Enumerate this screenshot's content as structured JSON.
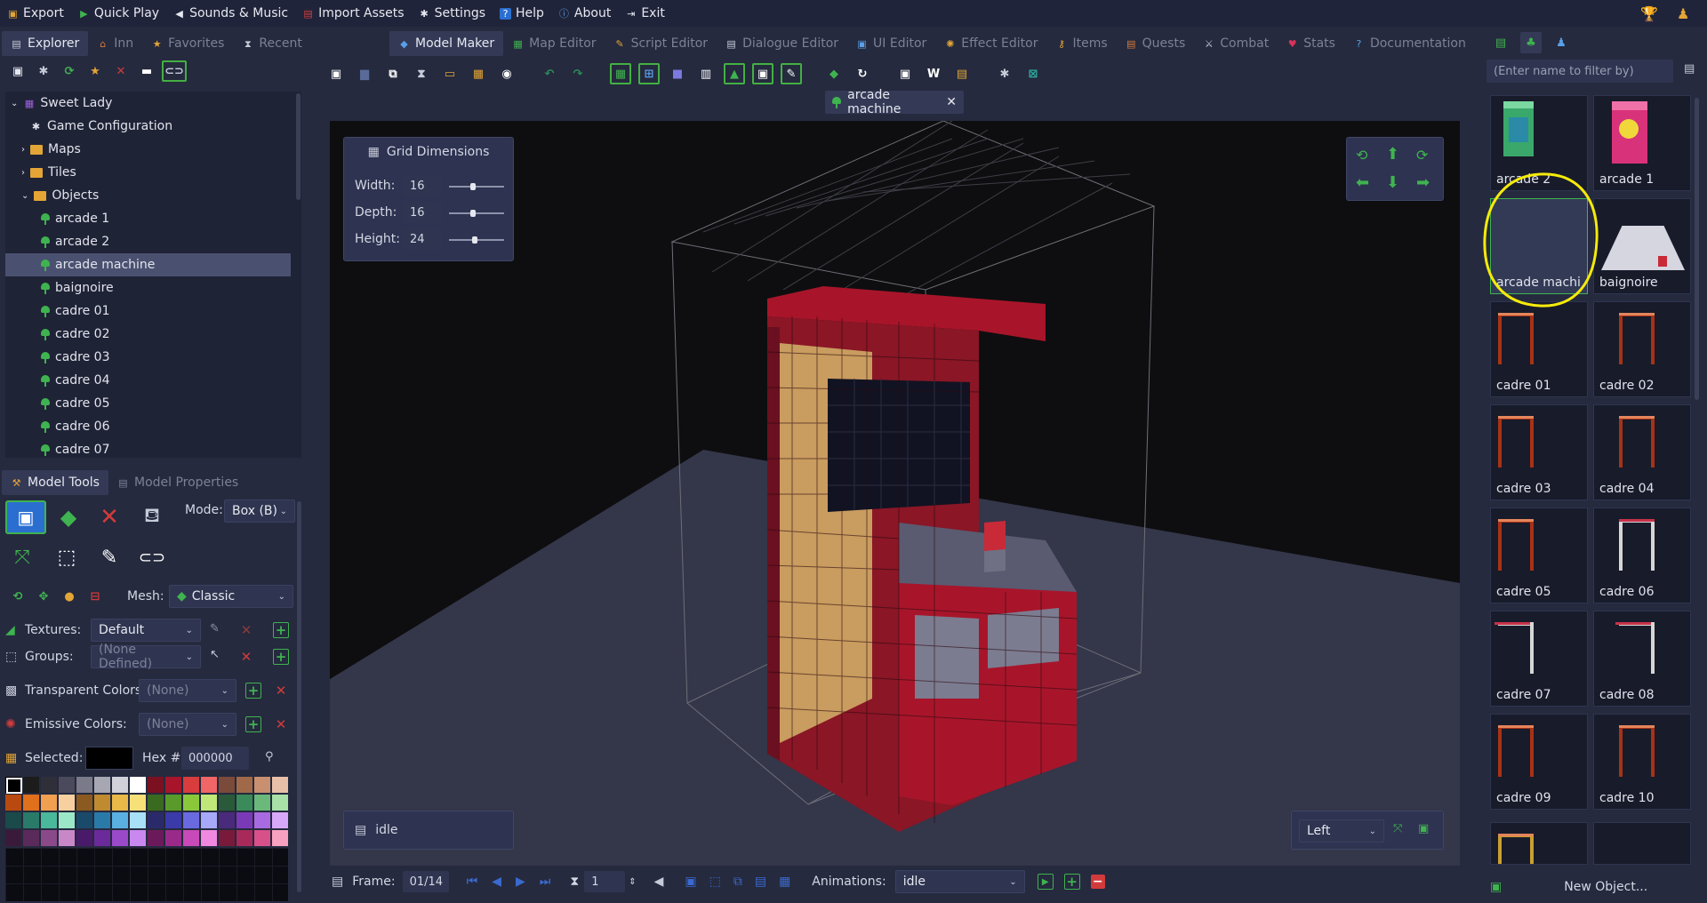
{
  "menu": [
    {
      "label": "Export",
      "icon": "export-icon"
    },
    {
      "label": "Quick Play",
      "icon": "play-icon"
    },
    {
      "label": "Sounds & Music",
      "icon": "speaker-icon"
    },
    {
      "label": "Import Assets",
      "icon": "import-icon"
    },
    {
      "label": "Settings",
      "icon": "gear-icon"
    },
    {
      "label": "Help",
      "icon": "help-icon"
    },
    {
      "label": "About",
      "icon": "info-icon"
    },
    {
      "label": "Exit",
      "icon": "exit-icon"
    }
  ],
  "left_tabs": [
    "Explorer",
    "Inn",
    "Favorites",
    "Recent"
  ],
  "editor_tabs": [
    "Model Maker",
    "Map Editor",
    "Script Editor",
    "Dialogue Editor",
    "UI Editor",
    "Effect Editor",
    "Items",
    "Quests",
    "Combat",
    "Stats",
    "Documentation"
  ],
  "tree": {
    "project": "Sweet Lady",
    "config": "Game Configuration",
    "maps": "Maps",
    "tiles": "Tiles",
    "objects": "Objects",
    "items": [
      "arcade 1",
      "arcade 2",
      "arcade machine",
      "baignoire",
      "cadre 01",
      "cadre 02",
      "cadre 03",
      "cadre 04",
      "cadre 05",
      "cadre 06",
      "cadre 07"
    ],
    "selected": "arcade machine"
  },
  "model_tabs": {
    "tools": "Model Tools",
    "properties": "Model Properties"
  },
  "tools": {
    "mode_label": "Mode:",
    "mode_value": "Box (B)",
    "mesh_label": "Mesh:",
    "mesh_value": "Classic",
    "textures_label": "Textures:",
    "textures_value": "Default",
    "groups_label": "Groups:",
    "groups_value": "(None Defined)",
    "transparent_label": "Transparent Colors:",
    "transparent_value": "(None)",
    "emissive_label": "Emissive Colors:",
    "emissive_value": "(None)",
    "selected_label": "Selected:",
    "hex_label": "Hex #:",
    "hex_value": "000000"
  },
  "palette": [
    "#000000",
    "#1c1c1c",
    "#2f2f3a",
    "#4a4a5c",
    "#7a7a88",
    "#a7a7b4",
    "#d1d1da",
    "#ffffff",
    "#7a1020",
    "#a8152a",
    "#d83c3c",
    "#f06666",
    "#7a4a3a",
    "#a06a4a",
    "#c89070",
    "#e8c0a8",
    "#b84a10",
    "#e0701c",
    "#f0a050",
    "#f8d0a0",
    "#8a5a20",
    "#c08a30",
    "#e8b848",
    "#f8e078",
    "#3a6a20",
    "#5a9a2a",
    "#8ac83a",
    "#c0e878",
    "#2a5a3a",
    "#3a8a5a",
    "#6ab87a",
    "#a8e0a8",
    "#1a4a4a",
    "#2a7a6a",
    "#4ab89a",
    "#9ae8c8",
    "#1a4a6a",
    "#2a7aa8",
    "#5ab0e0",
    "#a8e0f8",
    "#2a2a6a",
    "#3a3aa8",
    "#6a6ae0",
    "#a8a8f8",
    "#4a2a7a",
    "#7a3ab8",
    "#a86ae0",
    "#d8a8f8",
    "#3a1a3a",
    "#5a2a5a",
    "#8a4a8a",
    "#c888c8",
    "#4a1a6a",
    "#6a2a9a",
    "#9a4ac8",
    "#c888f0",
    "#6a1a5a",
    "#9a2a8a",
    "#c84ab8",
    "#f088e0",
    "#7a1a3a",
    "#a82a5a",
    "#d8508a",
    "#f8a0c0"
  ],
  "viewport_tab": "arcade machine",
  "grid": {
    "title": "Grid Dimensions",
    "width_label": "Width:",
    "width": "16",
    "depth_label": "Depth:",
    "depth": "16",
    "height_label": "Height:",
    "height": "24"
  },
  "animation_name": "idle",
  "view_select": "Left",
  "bottom": {
    "frame_label": "Frame:",
    "frame": "01/14",
    "speed": "1",
    "animations_label": "Animations:",
    "animation": "idle"
  },
  "filter_placeholder": "(Enter name to filter by)",
  "thumbnails": [
    "arcade 2",
    "arcade 1",
    "arcade machi",
    "baignoire",
    "cadre 01",
    "cadre 02",
    "cadre 03",
    "cadre 04",
    "cadre 05",
    "cadre 06",
    "cadre 07",
    "cadre 08",
    "cadre 09",
    "cadre 10"
  ],
  "new_object": "New Object...",
  "colors": {
    "accent_green": "#3fb34f",
    "danger_red": "#d23b3b",
    "selection_highlight": "#f5ea0b",
    "voxel_red": "#a8152a",
    "voxel_tan": "#d4b46a"
  }
}
